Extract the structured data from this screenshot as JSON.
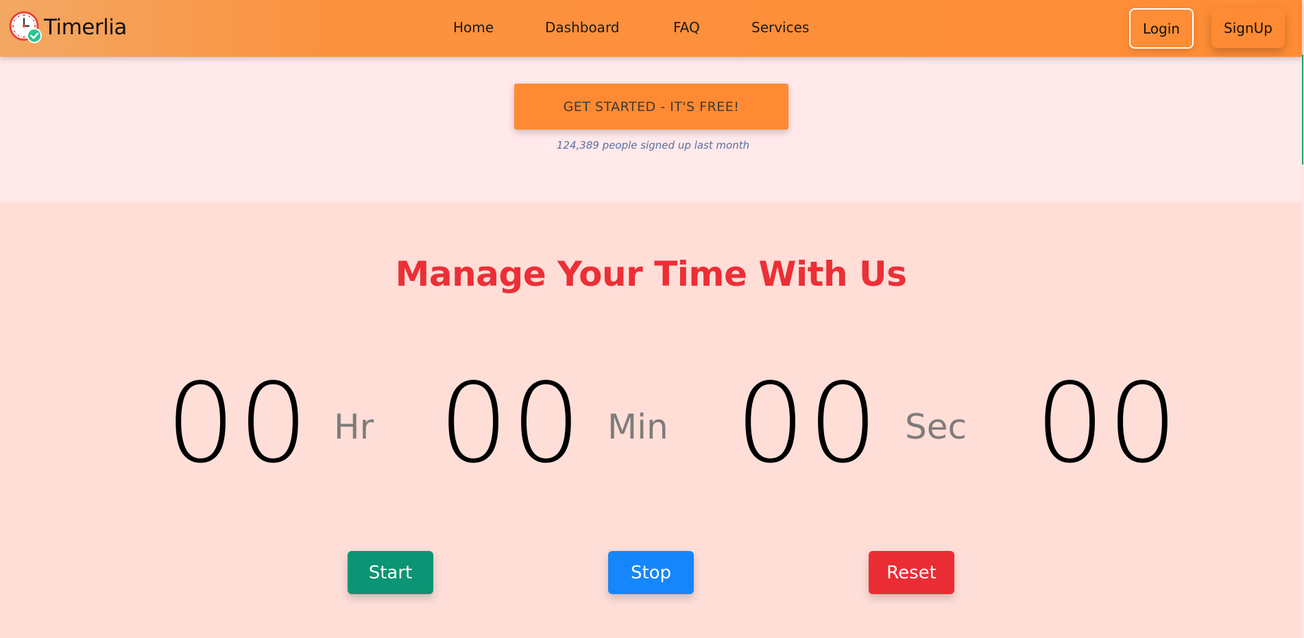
{
  "navbar": {
    "brand": "Timerlia",
    "links": [
      "Home",
      "Dashboard",
      "FAQ",
      "Services"
    ],
    "login_label": "Login",
    "signup_label": "SignUp"
  },
  "hero": {
    "cta_label": "GET STARTED - IT'S FREE!",
    "signup_note": "124,389 people signed up last month"
  },
  "timer": {
    "title": "Manage Your Time With Us",
    "hours": "00",
    "minutes": "00",
    "seconds": "00",
    "milliseconds": "00",
    "unit_hours": "Hr",
    "unit_minutes": "Min",
    "unit_seconds": "Sec",
    "start_label": "Start",
    "stop_label": "Stop",
    "reset_label": "Reset"
  },
  "colors": {
    "navbar_accent": "#ff8c35",
    "title_red": "#ec2f36",
    "start_green": "#0b9574",
    "stop_blue": "#1686fb",
    "reset_red": "#ea2d35"
  },
  "icons": {
    "brand_logo": "clock-check-icon"
  }
}
